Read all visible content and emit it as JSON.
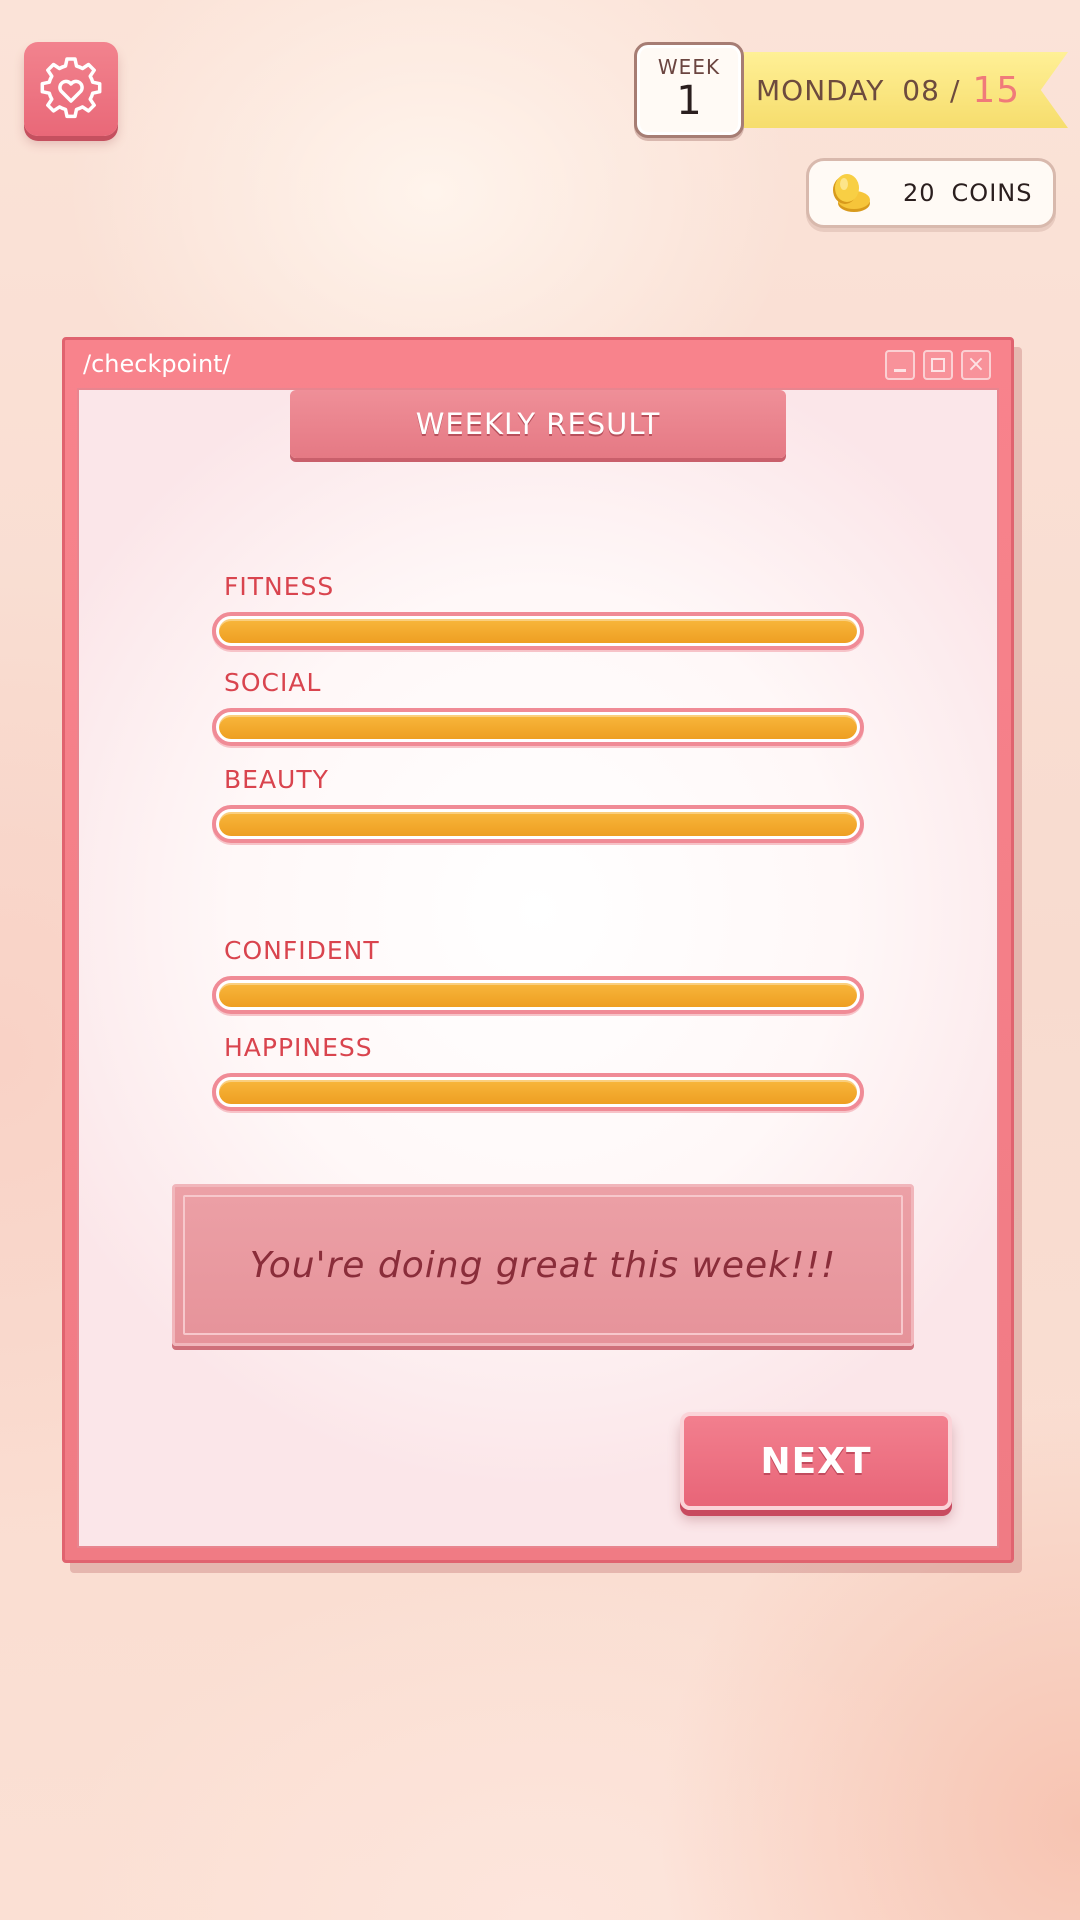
{
  "header": {
    "week_label": "WEEK",
    "week_number": "1",
    "day": "MONDAY",
    "day_current": "08",
    "day_separator": "/",
    "day_total": "15",
    "coins_amount": "20",
    "coins_label": "COINS"
  },
  "window": {
    "title": "/checkpoint/",
    "close_glyph": "×"
  },
  "result": {
    "heading": "WEEKLY RESULT",
    "stats": [
      {
        "label": "FITNESS",
        "level": 1.0
      },
      {
        "label": "SOCIAL",
        "level": 1.0
      },
      {
        "label": "BEAUTY",
        "level": 1.0
      },
      {
        "label": "CONFIDENT",
        "level": 1.0
      },
      {
        "label": "HAPPINESS",
        "level": 1.0
      }
    ],
    "message": "You're doing great this week!!!",
    "next_label": "NEXT"
  },
  "icons": {
    "settings": "gear-heart-icon",
    "coin": "coin-icon"
  },
  "colors": {
    "accent_pink": "#e96878",
    "stat_fill": "#f3a82c",
    "stat_label": "#d9444e",
    "ribbon": "#f6dd6d"
  }
}
